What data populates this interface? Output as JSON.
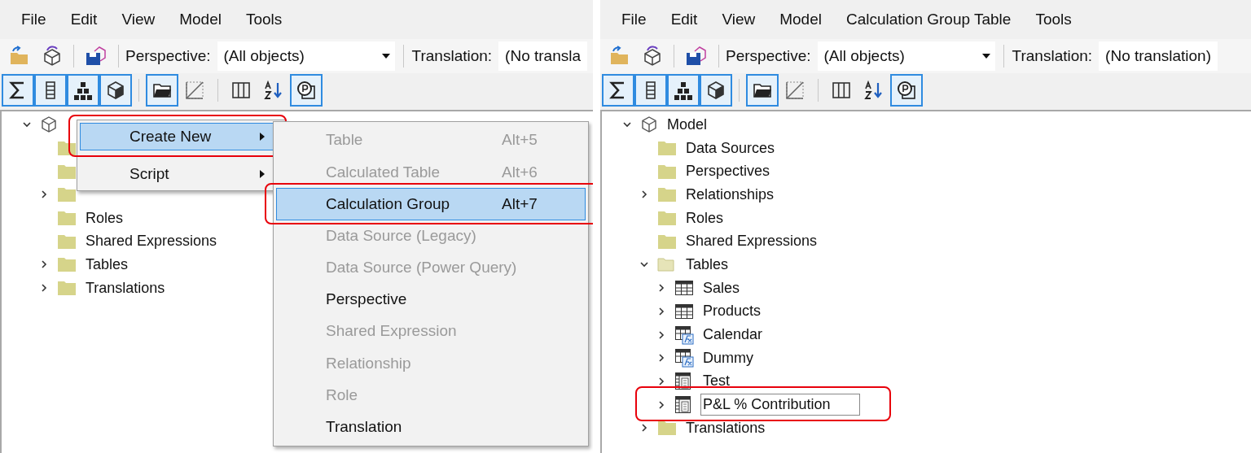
{
  "panels": [
    {
      "menu": [
        "File",
        "Edit",
        "View",
        "Model",
        "Tools"
      ],
      "toolbar": {
        "perspective_label": "Perspective:",
        "perspective_value": "(All objects)",
        "translation_label": "Translation:",
        "translation_value": "(No transla"
      },
      "view_buttons": [
        {
          "kind": "sigma",
          "pressed": true
        },
        {
          "kind": "list",
          "pressed": true
        },
        {
          "kind": "hierarchy",
          "pressed": true
        },
        {
          "kind": "cube",
          "pressed": true
        },
        {
          "kind": "folder",
          "pressed": true
        },
        {
          "kind": "hidden",
          "pressed": false
        },
        {
          "kind": "columns",
          "pressed": false
        },
        {
          "kind": "sort",
          "pressed": false
        },
        {
          "kind": "info",
          "pressed": true
        }
      ],
      "tree": [
        {
          "kind": "model",
          "expanded": true,
          "children": [
            {
              "kind": "folder"
            },
            {
              "kind": "folder"
            },
            {
              "kind": "folder",
              "expanded": false
            },
            {
              "kind": "folder",
              "label": "Roles"
            },
            {
              "kind": "folder",
              "label": "Shared Expressions"
            },
            {
              "kind": "folder",
              "label": "Tables",
              "expanded": false
            },
            {
              "kind": "folder",
              "label": "Translations",
              "expanded": false
            }
          ]
        }
      ],
      "context_menu": {
        "items": [
          {
            "label": "Create New",
            "selected": true,
            "annotated": true
          },
          {
            "label": "Script",
            "selected": false,
            "annotated": false
          }
        ],
        "submenu": [
          {
            "label": "Table",
            "shortcut": "Alt+5",
            "disabled": true,
            "selected": false,
            "annotated": false
          },
          {
            "label": "Calculated Table",
            "shortcut": "Alt+6",
            "disabled": true,
            "selected": false,
            "annotated": false
          },
          {
            "label": "Calculation Group",
            "shortcut": "Alt+7",
            "disabled": false,
            "selected": true,
            "annotated": true
          },
          {
            "label": "Data Source (Legacy)",
            "disabled": true,
            "selected": false,
            "annotated": false
          },
          {
            "label": "Data Source (Power Query)",
            "disabled": true,
            "selected": false,
            "annotated": false
          },
          {
            "label": "Perspective",
            "disabled": false,
            "selected": false,
            "annotated": false
          },
          {
            "label": "Shared Expression",
            "disabled": true,
            "selected": false,
            "annotated": false
          },
          {
            "label": "Relationship",
            "disabled": true,
            "selected": false,
            "annotated": false
          },
          {
            "label": "Role",
            "disabled": true,
            "selected": false,
            "annotated": false
          },
          {
            "label": "Translation",
            "disabled": false,
            "selected": false,
            "annotated": false
          }
        ]
      }
    },
    {
      "menu": [
        "File",
        "Edit",
        "View",
        "Model",
        "Calculation Group Table",
        "Tools"
      ],
      "toolbar": {
        "perspective_label": "Perspective:",
        "perspective_value": "(All objects)",
        "translation_label": "Translation:",
        "translation_value": "(No translation)"
      },
      "view_buttons": [
        {
          "kind": "sigma",
          "pressed": true
        },
        {
          "kind": "list",
          "pressed": true
        },
        {
          "kind": "hierarchy",
          "pressed": true
        },
        {
          "kind": "cube",
          "pressed": true
        },
        {
          "kind": "folder",
          "pressed": true
        },
        {
          "kind": "hidden",
          "pressed": false
        },
        {
          "kind": "columns",
          "pressed": false
        },
        {
          "kind": "sort",
          "pressed": false
        },
        {
          "kind": "info",
          "pressed": true
        }
      ],
      "tree": [
        {
          "kind": "model",
          "label": "Model",
          "expanded": true,
          "children": [
            {
              "kind": "folder",
              "label": "Data Sources"
            },
            {
              "kind": "folder",
              "label": "Perspectives"
            },
            {
              "kind": "folder",
              "label": "Relationships",
              "expanded": false
            },
            {
              "kind": "folder",
              "label": "Roles"
            },
            {
              "kind": "folder",
              "label": "Shared Expressions"
            },
            {
              "kind": "folder",
              "label": "Tables",
              "expanded": true,
              "children": [
                {
                  "kind": "table",
                  "label": "Sales",
                  "expanded": false
                },
                {
                  "kind": "table",
                  "label": "Products",
                  "expanded": false
                },
                {
                  "kind": "calculated-table",
                  "label": "Calendar",
                  "expanded": false
                },
                {
                  "kind": "calculated-table",
                  "label": "Dummy",
                  "expanded": false
                },
                {
                  "kind": "calculation-group",
                  "label": "Test",
                  "expanded": false
                },
                {
                  "kind": "calculation-group",
                  "label": "P&L % Contribution",
                  "expanded": false,
                  "editing": true,
                  "annotated": true
                }
              ]
            },
            {
              "kind": "folder",
              "label": "Translations",
              "expanded": false
            }
          ]
        }
      ]
    }
  ]
}
